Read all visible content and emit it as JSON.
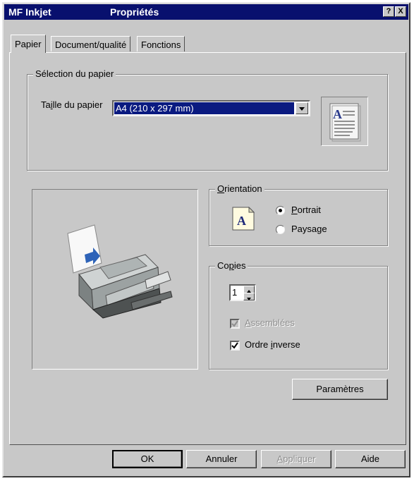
{
  "window": {
    "app_name": "MF Inkjet",
    "title": "Propriétés",
    "help_button": "?",
    "close_button": "X"
  },
  "tabs": [
    {
      "label": "Papier",
      "active": true
    },
    {
      "label": "Document/qualité",
      "active": false
    },
    {
      "label": "Fonctions",
      "active": false
    }
  ],
  "paper_selection": {
    "legend": "Sélection du papier",
    "size_label_pre": "Ta",
    "size_label_mnemonic": "i",
    "size_label_post": "lle du papier",
    "size_value": "A4 (210 x 297 mm)",
    "preview_icon": "paper-document-icon"
  },
  "orientation": {
    "legend_mnemonic": "O",
    "legend_rest": "rientation",
    "icon_letter": "A",
    "portrait_mnemonic": "P",
    "portrait_rest": "ortrait",
    "landscape_pre": "Paysa",
    "landscape_mnemonic": "g",
    "landscape_post": "e",
    "selected": "portrait"
  },
  "copies": {
    "legend_pre": "Co",
    "legend_mnemonic": "p",
    "legend_post": "ies",
    "value": "1",
    "collate_mnemonic": "A",
    "collate_rest": "ssemblées",
    "collate_checked": true,
    "collate_enabled": false,
    "reverse_pre": "Ordre ",
    "reverse_mnemonic": "i",
    "reverse_post": "nverse",
    "reverse_checked": true
  },
  "params_button": "Paramètres",
  "footer": {
    "ok": "OK",
    "cancel": "Annuler",
    "apply_mnemonic": "A",
    "apply_rest": "ppliquer",
    "help": "Aide"
  },
  "colors": {
    "titlebar": "#08106e",
    "dialog_face": "#c8c8c8",
    "selection": "#0a1a80"
  }
}
